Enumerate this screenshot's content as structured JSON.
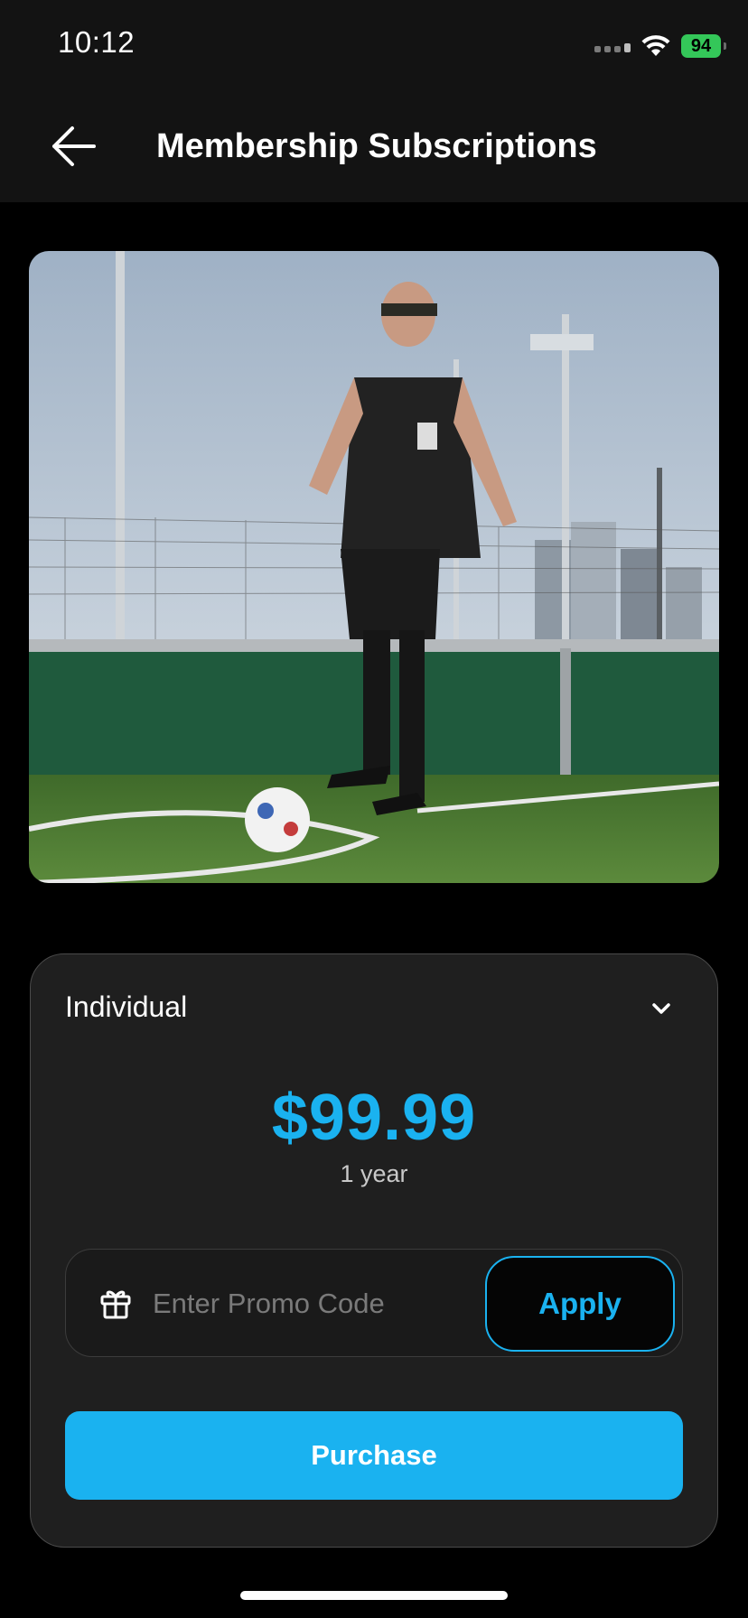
{
  "status_bar": {
    "time": "10:12",
    "battery": "94",
    "icons": [
      "signal-icon",
      "wifi-icon",
      "battery-charging-icon"
    ]
  },
  "header": {
    "title": "Membership Subscriptions",
    "back_icon": "arrow-left-icon"
  },
  "hero_image": {
    "description_icon": "soccer-player-photo"
  },
  "plan": {
    "selected": "Individual",
    "dropdown_icon": "chevron-down-icon",
    "price": "$99.99",
    "period": "1 year"
  },
  "promo": {
    "placeholder": "Enter Promo Code",
    "value": "",
    "icon": "gift-icon",
    "apply_label": "Apply"
  },
  "purchase": {
    "label": "Purchase"
  },
  "colors": {
    "accent": "#1ab2f0",
    "card_bg": "#1f1f1f",
    "bar_bg": "#131313",
    "battery": "#34c759"
  }
}
